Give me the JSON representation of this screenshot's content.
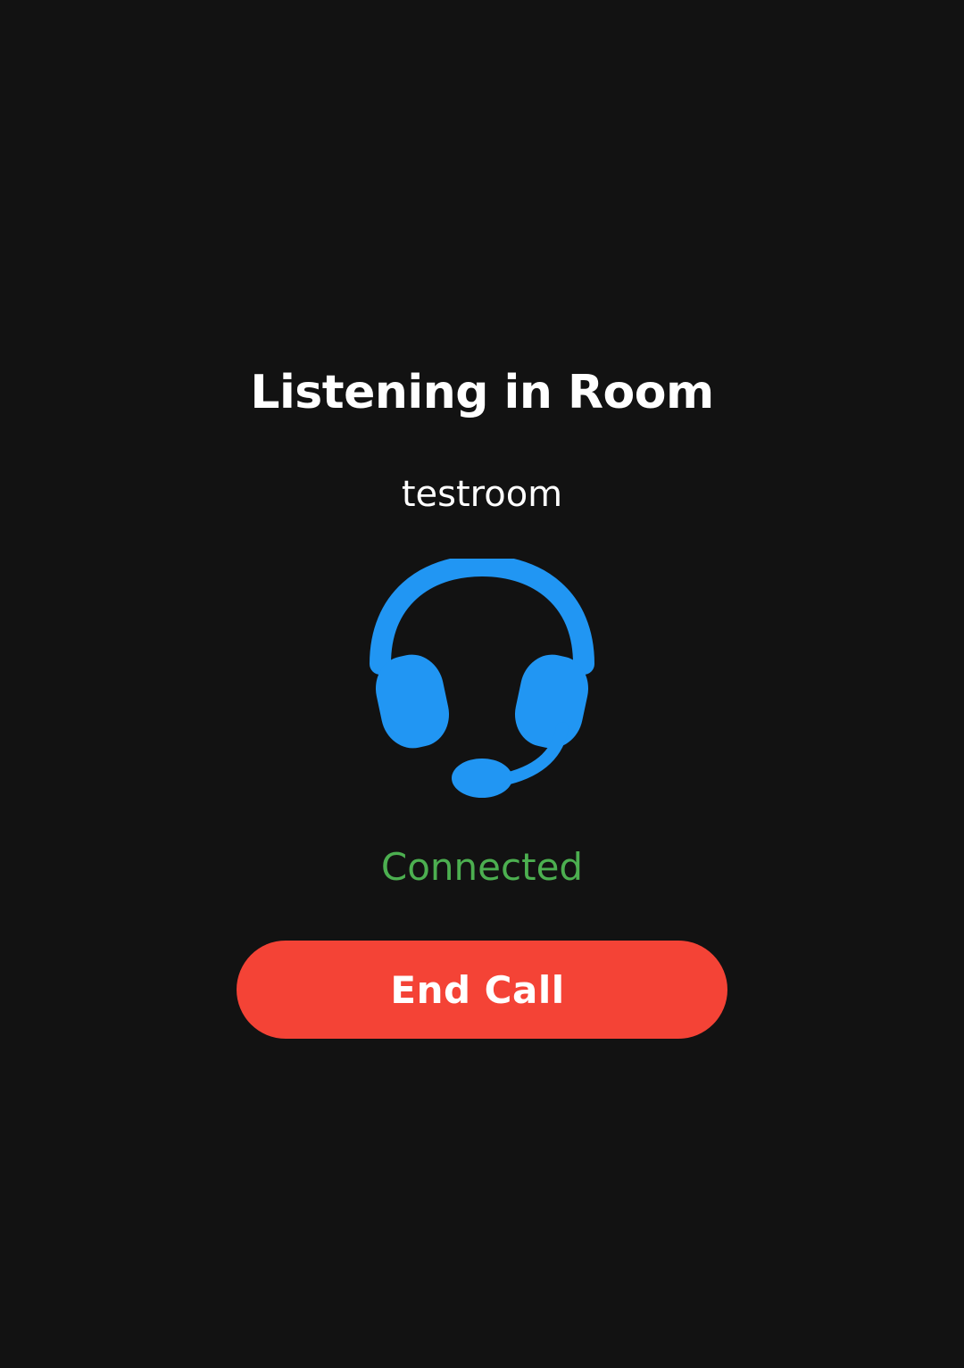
{
  "screen": {
    "title": "Listening in Room",
    "room_name": "testroom",
    "icon": "headset-icon",
    "status": "Connected",
    "end_call_label": "End Call"
  },
  "colors": {
    "background": "#121212",
    "accent": "#2196F3",
    "status_connected": "#4CAF50",
    "end_call": "#F44336",
    "text": "#FFFFFF"
  }
}
